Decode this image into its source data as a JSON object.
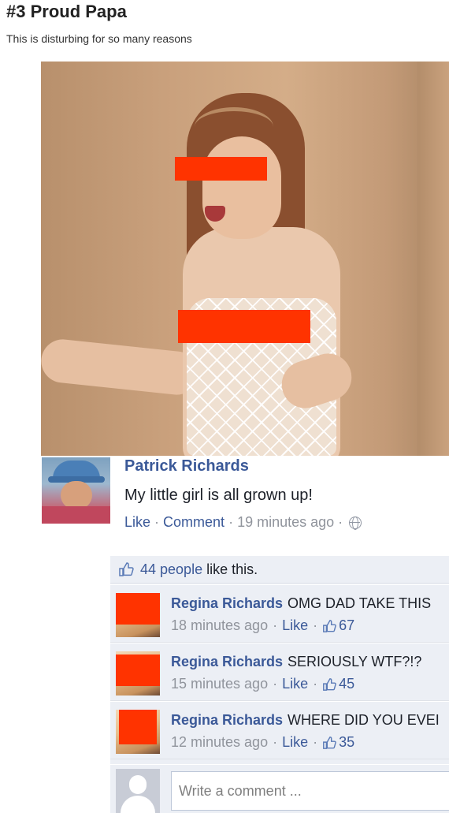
{
  "article": {
    "heading": "#3 Proud Papa",
    "subheading": "This is disturbing for so many reasons"
  },
  "photo": {
    "censor_color": "#ff3300"
  },
  "post": {
    "author": "Patrick Richards",
    "text": "My little girl is all grown up!",
    "like_label": "Like",
    "comment_label": "Comment",
    "timestamp": "19 minutes ago",
    "separator": "·",
    "privacy_icon": "globe-icon"
  },
  "likes": {
    "count_text": "44 people",
    "suffix": "like this.",
    "icon": "thumb-icon"
  },
  "comments": [
    {
      "author": "Regina Richards",
      "text": "OMG DAD TAKE THIS",
      "time": "18 minutes ago",
      "like_label": "Like",
      "likes": "67"
    },
    {
      "author": "Regina Richards",
      "text": "SERIOUSLY WTF?!?",
      "time": "15 minutes ago",
      "like_label": "Like",
      "likes": "45"
    },
    {
      "author": "Regina Richards",
      "text": "WHERE DID YOU EVEI",
      "time": "12 minutes ago",
      "like_label": "Like",
      "likes": "35"
    }
  ],
  "composer": {
    "placeholder": "Write a comment ..."
  },
  "colors": {
    "link": "#3b5998",
    "meta": "#90949c",
    "comment_bg": "#eceff5"
  }
}
